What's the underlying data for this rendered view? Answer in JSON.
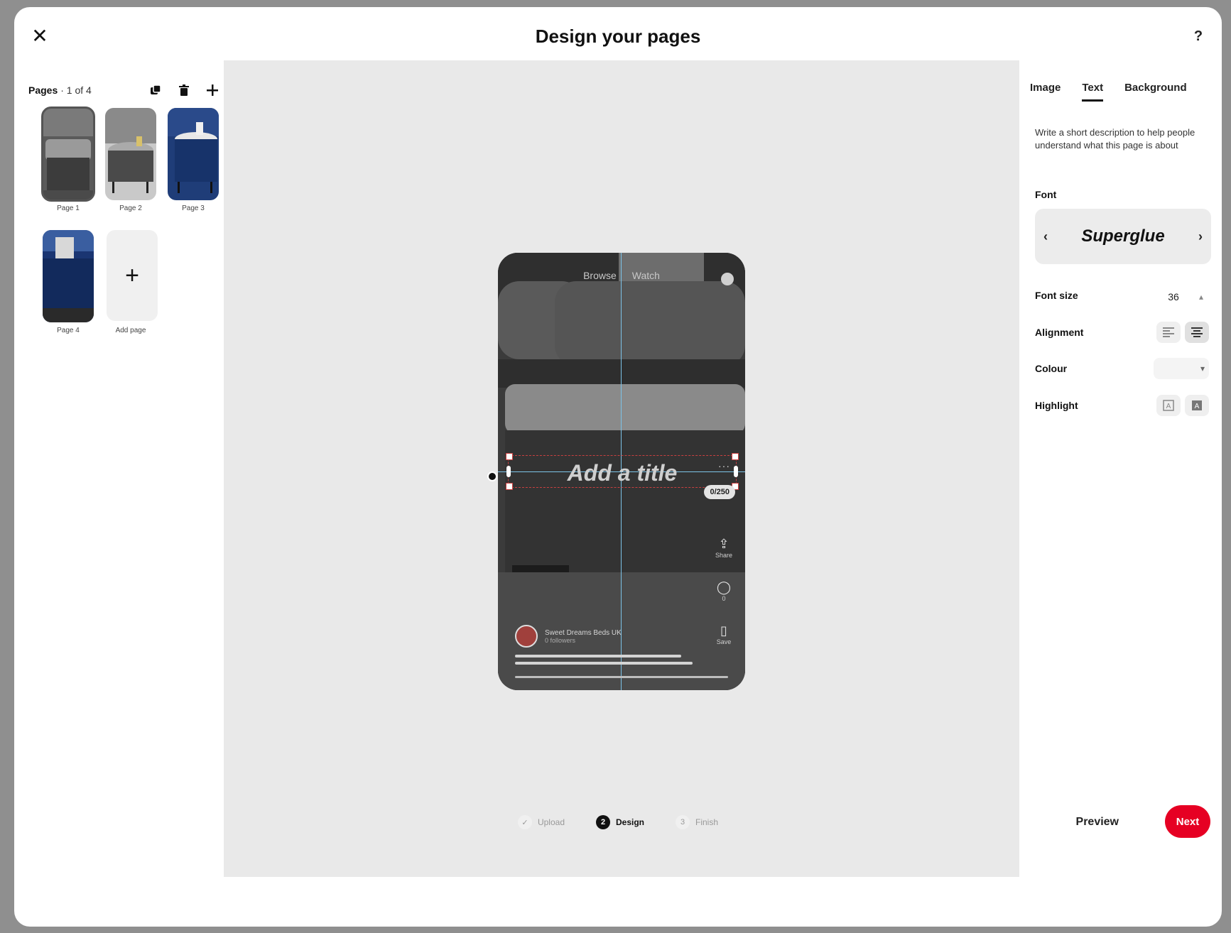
{
  "header": {
    "close_icon": "close-icon",
    "title": "Design your pages",
    "help_label": "?"
  },
  "pages_panel": {
    "label": "Pages",
    "count": "· 1 of 4",
    "tools": [
      "duplicate-icon",
      "trash-icon",
      "plus-icon"
    ],
    "pages": [
      {
        "label": "Page 1"
      },
      {
        "label": "Page 2"
      },
      {
        "label": "Page 3"
      },
      {
        "label": "Page 4"
      }
    ],
    "add_page_label": "Add page",
    "add_icon": "+"
  },
  "preview": {
    "tabs": [
      "Browse",
      "Watch"
    ],
    "title_placeholder": "Add a title",
    "char_count": "0/250",
    "more_icon": "···",
    "actions": [
      {
        "icon": "share-icon",
        "glyph": "⇪",
        "label": "Share"
      },
      {
        "icon": "comment-icon",
        "glyph": "◯",
        "label": "0"
      },
      {
        "icon": "save-icon",
        "glyph": "▯",
        "label": "Save"
      }
    ],
    "creator_name": "Sweet Dreams Beds UK",
    "creator_sub": "0 followers"
  },
  "properties": {
    "tabs": [
      {
        "label": "Image",
        "active": false
      },
      {
        "label": "Text",
        "active": true
      },
      {
        "label": "Background",
        "active": false
      }
    ],
    "hint": "Write a short description to help people understand what this page is about",
    "font_label": "Font",
    "font_name": "Superglue",
    "font_prev": "‹",
    "font_next": "›",
    "font_size_label": "Font size",
    "font_size_value": "36",
    "alignment_label": "Alignment",
    "colour_label": "Colour",
    "highlight_label": "Highlight"
  },
  "footer": {
    "steps": [
      {
        "marker": "✓",
        "label": "Upload",
        "state": "done"
      },
      {
        "marker": "2",
        "label": "Design",
        "state": "current"
      },
      {
        "marker": "3",
        "label": "Finish",
        "state": "upcoming"
      }
    ],
    "preview_label": "Preview",
    "next_label": "Next"
  },
  "colors": {
    "accent": "#e60023",
    "guide": "#7cc3e8",
    "canvas_bg": "#e9e9e9"
  }
}
